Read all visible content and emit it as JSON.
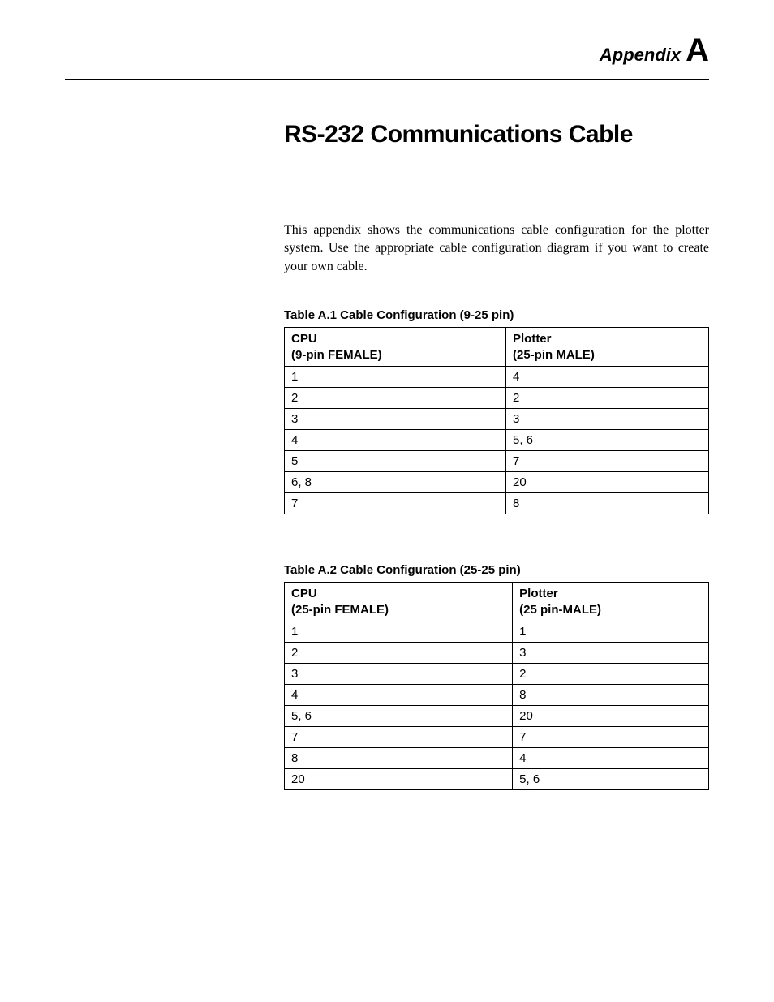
{
  "header": {
    "label": "Appendix",
    "letter": "A"
  },
  "title": "RS-232 Communications Cable",
  "intro": "This appendix shows the communications cable configuration for the plotter system. Use the appropriate cable configuration diagram if you want to create your own cable.",
  "table1": {
    "caption": "Table A.1 Cable Configuration (9-25 pin)",
    "header_col1_line1": "CPU",
    "header_col1_line2": "(9-pin FEMALE)",
    "header_col2_line1": "Plotter",
    "header_col2_line2": "(25-pin MALE)",
    "rows": [
      {
        "c1": "1",
        "c2": "4"
      },
      {
        "c1": "2",
        "c2": "2"
      },
      {
        "c1": "3",
        "c2": "3"
      },
      {
        "c1": "4",
        "c2": "5, 6"
      },
      {
        "c1": "5",
        "c2": "7"
      },
      {
        "c1": "6, 8",
        "c2": "20"
      },
      {
        "c1": "7",
        "c2": "8"
      }
    ]
  },
  "table2": {
    "caption": "Table A.2 Cable Configuration (25-25 pin)",
    "header_col1_line1": "CPU",
    "header_col1_line2": "(25-pin FEMALE)",
    "header_col2_line1": "Plotter",
    "header_col2_line2": "(25 pin-MALE)",
    "rows": [
      {
        "c1": "1",
        "c2": "1"
      },
      {
        "c1": "2",
        "c2": "3"
      },
      {
        "c1": "3",
        "c2": "2"
      },
      {
        "c1": "4",
        "c2": "8"
      },
      {
        "c1": "5, 6",
        "c2": "20"
      },
      {
        "c1": "7",
        "c2": "7"
      },
      {
        "c1": "8",
        "c2": "4"
      },
      {
        "c1": "20",
        "c2": "5, 6"
      }
    ]
  }
}
